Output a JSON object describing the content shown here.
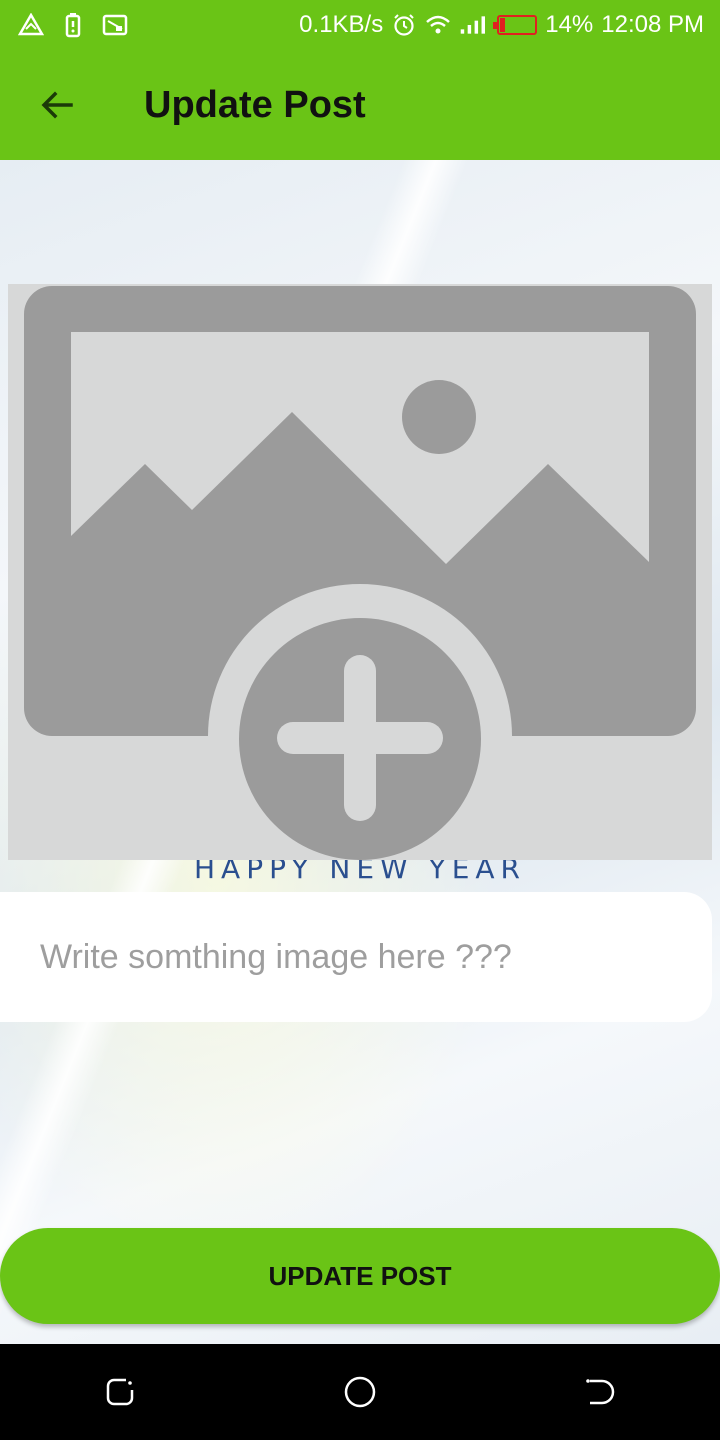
{
  "status_bar": {
    "network_speed": "0.1KB/s",
    "battery_percent": "14%",
    "time": "12:08 PM",
    "battery_level": 0.14,
    "battery_color": "#e02020",
    "icons": [
      "alert-icon",
      "battery-saver-icon",
      "cast-icon",
      "alarm-icon",
      "wifi-icon",
      "signal-icon",
      "battery-icon"
    ]
  },
  "app_bar": {
    "title": "Update Post",
    "back_icon": "arrow-left-icon",
    "background": "#6ac416"
  },
  "image_picker": {
    "icon": "add-image-icon",
    "background_text": "HAPPY NEW YEAR"
  },
  "caption": {
    "placeholder": "Write somthing image here ???",
    "value": ""
  },
  "update_button": {
    "label": "UPDATE POST"
  },
  "nav_bar": {
    "buttons": [
      "recent-apps-icon",
      "home-icon",
      "back-icon"
    ]
  }
}
